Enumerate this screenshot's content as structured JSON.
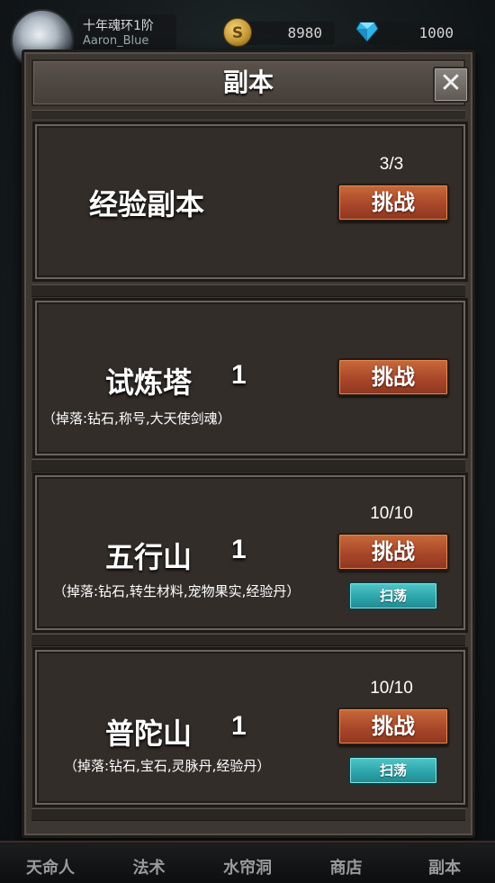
{
  "player": {
    "rank": "十年魂环1阶",
    "name": "Aaron_Blue"
  },
  "currency": {
    "gold": "8980",
    "gems": "1000",
    "gold_symbol": "S"
  },
  "dialog": {
    "title": "副本",
    "close_symbol": "✕"
  },
  "dungeons": [
    {
      "title": "经验副本",
      "level": "",
      "drops": "",
      "count": "3/3",
      "challenge_label": "挑战",
      "sweep_label": ""
    },
    {
      "title": "试炼塔",
      "level": "1",
      "drops": "（掉落:钻石,称号,大天使剑魂）",
      "count": "",
      "challenge_label": "挑战",
      "sweep_label": ""
    },
    {
      "title": "五行山",
      "level": "1",
      "drops": "（掉落:钻石,转生材料,宠物果实,经验丹）",
      "count": "10/10",
      "challenge_label": "挑战",
      "sweep_label": "扫荡"
    },
    {
      "title": "普陀山",
      "level": "1",
      "drops": "（掉落:钻石,宝石,灵脉丹,经验丹）",
      "count": "10/10",
      "challenge_label": "挑战",
      "sweep_label": "扫荡"
    }
  ],
  "bottom_nav": [
    "天命人",
    "法术",
    "水帘洞",
    "商店",
    "副本"
  ],
  "colors": {
    "challenge": "#a9472a",
    "sweep": "#2ba2a8",
    "panel": "#3d3732"
  }
}
